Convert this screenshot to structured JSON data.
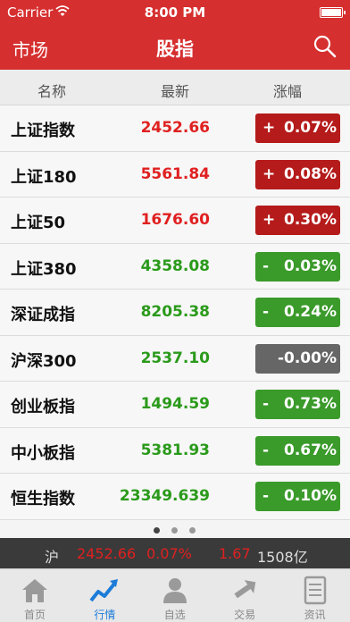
{
  "status": {
    "carrier": "Carrier",
    "time": "8:00 PM"
  },
  "nav": {
    "back_label": "市场",
    "title": "股指"
  },
  "columns": {
    "name": "名称",
    "latest": "最新",
    "change": "涨幅"
  },
  "rows": [
    {
      "name": "上证指数",
      "price": "2452.66",
      "sign": "+",
      "pct": "0.07%",
      "dir": "up"
    },
    {
      "name": "上证180",
      "price": "5561.84",
      "sign": "+",
      "pct": "0.08%",
      "dir": "up"
    },
    {
      "name": "上证50",
      "price": "1676.60",
      "sign": "+",
      "pct": "0.30%",
      "dir": "up"
    },
    {
      "name": "上证380",
      "price": "4358.08",
      "sign": "-",
      "pct": "0.03%",
      "dir": "down"
    },
    {
      "name": "深证成指",
      "price": "8205.38",
      "sign": "-",
      "pct": "0.24%",
      "dir": "down"
    },
    {
      "name": "沪深300",
      "price": "2537.10",
      "sign": "",
      "pct": "-0.00%",
      "dir": "flat"
    },
    {
      "name": "创业板指",
      "price": "1494.59",
      "sign": "-",
      "pct": "0.73%",
      "dir": "down"
    },
    {
      "name": "中小板指",
      "price": "5381.93",
      "sign": "-",
      "pct": "0.67%",
      "dir": "down"
    },
    {
      "name": "恒生指数",
      "price": "23349.639",
      "sign": "-",
      "pct": "0.10%",
      "dir": "down"
    }
  ],
  "pager": {
    "pages": 3,
    "current": 1
  },
  "ticker": {
    "market": "沪",
    "price": "2452.66",
    "pct": "0.07%",
    "change": "1.67",
    "volume": "1508亿"
  },
  "tabs": [
    {
      "label": "首页",
      "icon": "home-icon",
      "active": false
    },
    {
      "label": "行情",
      "icon": "trend-chart-icon",
      "active": true
    },
    {
      "label": "自选",
      "icon": "user-icon",
      "active": false
    },
    {
      "label": "交易",
      "icon": "exchange-arrows-icon",
      "active": false
    },
    {
      "label": "资讯",
      "icon": "document-icon",
      "active": false
    }
  ],
  "colors": {
    "brand": "#d62f2f",
    "up": "#e02020",
    "down": "#2a9a1a",
    "active_tab": "#1c7cd8"
  }
}
